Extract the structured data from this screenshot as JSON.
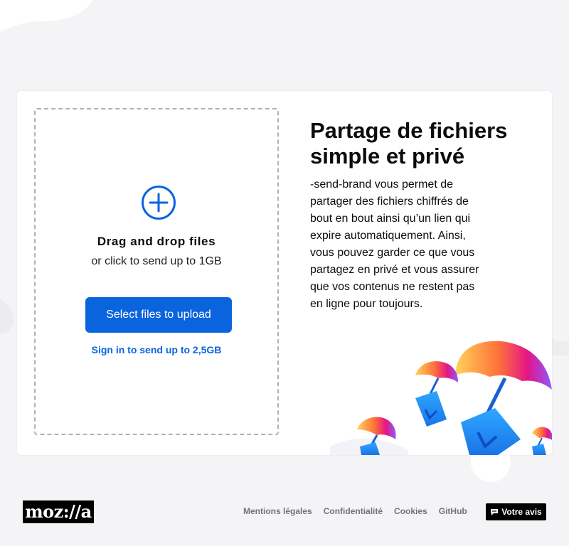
{
  "upload": {
    "drop_title": "Drag and drop files",
    "drop_subtitle": "or click to send up to 1GB",
    "select_button": "Select files to upload",
    "signin_link": "Sign in to send up to 2,5GB"
  },
  "intro": {
    "title": "Partage de fichiers simple et privé",
    "description": "-send-brand vous permet de partager des fichiers chiffrés de bout en bout ainsi qu’un lien qui expire automatiquement. Ainsi, vous pouvez garder ce que vous partagez en privé et vous assurer que vos contenus ne restent pas en ligne pour toujours."
  },
  "footer": {
    "logo": "moz://a",
    "links": [
      "Mentions légales",
      "Confidentialité",
      "Cookies",
      "GitHub"
    ],
    "feedback": "Votre avis"
  },
  "colors": {
    "accent": "#0a64de",
    "background": "#f4f4f6",
    "card": "#ffffff",
    "footer_link": "#737373"
  },
  "icons": {
    "add": "plus-circle-icon",
    "feedback": "speech-bubble-icon"
  }
}
